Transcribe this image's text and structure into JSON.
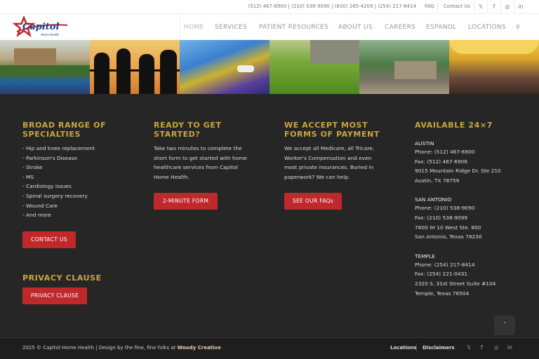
{
  "topbar": {
    "phones": "(512) 467-6900 | (210) 538-9090 | (830) 265-4209 | (254) 217-8414",
    "faq": "FAQ",
    "contact": "Contact Us",
    "social": [
      {
        "icon": "twitter-icon",
        "glyph": "𝕏"
      },
      {
        "icon": "facebook-icon",
        "glyph": "f"
      },
      {
        "icon": "instagram-icon",
        "glyph": "◎"
      },
      {
        "icon": "linkedin-icon",
        "glyph": "in"
      }
    ]
  },
  "header": {
    "logo_word": "Capitol",
    "logo_sub": "Home Health",
    "nav": [
      "HOME",
      "SERVICES",
      "PATIENT RESOURCES",
      "ABOUT US",
      "CAREERS",
      "ESPANOL",
      "LOCATIONS"
    ],
    "active_nav": "HOME",
    "search_glyph": "⚲"
  },
  "columns": {
    "specialties": {
      "heading_1": "BROAD RANGE OF",
      "heading_2": "SPECIALTIES",
      "items": [
        "- Hip and knee replacement",
        "- Parkinson's Disease",
        "- Stroke",
        "- MS",
        "- Cardiology issues",
        "- Spinal surgery recovery",
        "- Wound Care",
        "- And more"
      ],
      "button": "CONTACT US"
    },
    "privacy": {
      "heading": "PRIVACY CLAUSE",
      "button": "PRIVACY CLAUSE"
    },
    "started": {
      "heading_1": "READY TO GET",
      "heading_2": "STARTED?",
      "lines": [
        "Take two minutes to complete the",
        "short form to get started with home",
        "healthcare services from Capitol",
        "Home Health."
      ],
      "button": "2-MINUTE FORM"
    },
    "payment": {
      "heading_1": "WE ACCEPT MOST",
      "heading_2": "FORMS OF PAYMENT",
      "lines": [
        "We accept all Medicare, all Tricare,",
        "Worker's Compensation and even",
        "most private insurances. Buried in",
        "paperwork? We can help."
      ],
      "button": "SEE OUR FAQs"
    },
    "available": {
      "heading": "AVAILABLE 24×7",
      "locations": [
        {
          "name": "AUSTIN",
          "lines": [
            "Phone: (512) 467-6900",
            "Fax: (512) 467-6906",
            "9015 Mountain Ridge Dr. Ste 210",
            "Austin, TX 78759"
          ]
        },
        {
          "name": "SAN ANTONIO",
          "lines": [
            "Phone: (210) 538-9090",
            "Fax: (210) 538-9099",
            "7800 IH 10 West Ste. 800",
            "San Antonio, Texas 78230"
          ]
        },
        {
          "name": "TEMPLE",
          "lines": [
            "Phone: (254) 217-8414",
            "Fax: (254) 221-0431",
            "2320 S. 31st Street Suite #104",
            "Temple, Texas 76504"
          ]
        }
      ]
    }
  },
  "scroll_top_glyph": "˄",
  "bottombar": {
    "copyright_text": "2025 © Capitol Home Health | Design by the fine, fine folks at ",
    "credit": "Woody Creative",
    "links": [
      "Locations",
      "Disclaimers"
    ],
    "social": [
      {
        "icon": "twitter-icon",
        "glyph": "𝕏"
      },
      {
        "icon": "facebook-icon",
        "glyph": "f"
      },
      {
        "icon": "instagram-icon",
        "glyph": "◎"
      },
      {
        "icon": "linkedin-icon",
        "glyph": "in"
      }
    ]
  },
  "colors": {
    "accent_red": "#c0292b",
    "heading_gold": "#c9a73e",
    "footer_bg": "#262626",
    "logo_blue": "#1b3f8f"
  }
}
